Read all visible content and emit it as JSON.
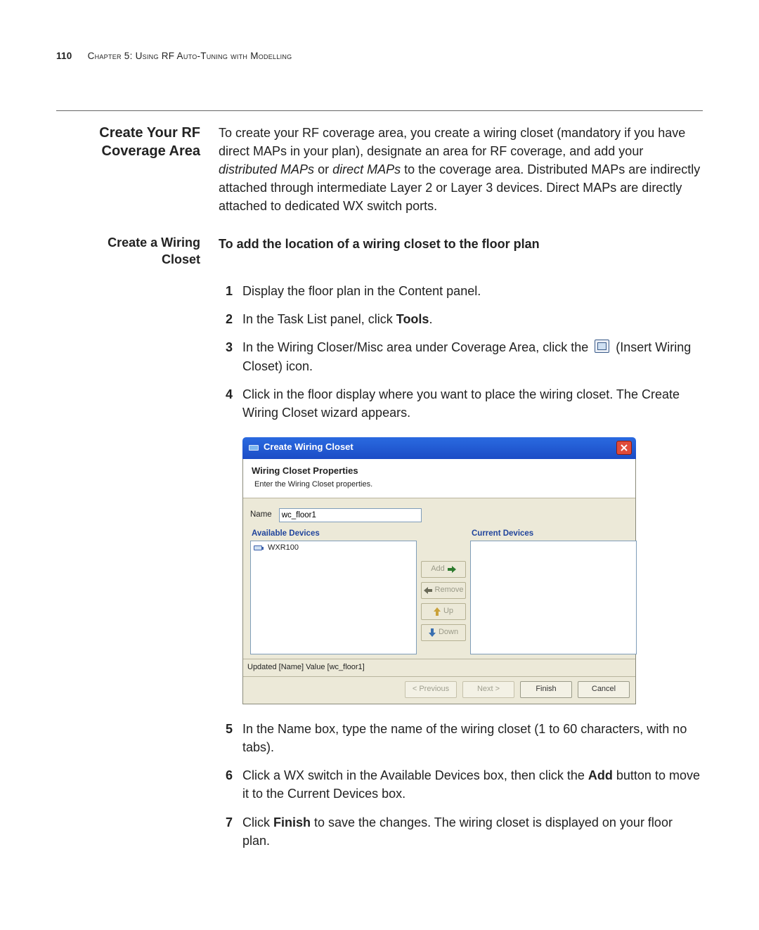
{
  "page": {
    "number": "110",
    "chapter_line": "Chapter 5: Using RF Auto-Tuning with Modelling"
  },
  "section": {
    "side_title_a": "Create Your RF",
    "side_title_b": "Coverage Area",
    "intro": "To create your RF coverage area, you create a wiring closet (mandatory if you have direct MAPs in your plan), designate an area for RF coverage, and add your ",
    "intro_em1": "distributed MAPs",
    "intro_mid": " or ",
    "intro_em2": "direct MAPs",
    "intro_tail": " to the coverage area. Distributed MAPs are indirectly attached through intermediate Layer 2 or Layer 3 devices. Direct MAPs are directly attached to dedicated WX switch ports."
  },
  "sub": {
    "side_a": "Create a Wiring",
    "side_b": "Closet",
    "lead": "To add the location of a wiring closet to the floor plan"
  },
  "steps_top": [
    {
      "n": "1",
      "text": "Display the floor plan in the Content panel."
    },
    {
      "n": "2",
      "pre": "In the Task List panel, click ",
      "bold": "Tools",
      "post": "."
    },
    {
      "n": "3",
      "pre": "In the Wiring Closer/Misc area under Coverage Area, click the ",
      "post_icon": " (Insert Wiring Closet) icon."
    },
    {
      "n": "4",
      "text": "Click in the floor display where you want to place the wiring closet. The Create Wiring Closet wizard appears."
    }
  ],
  "dialog": {
    "title": "Create Wiring Closet",
    "header_title": "Wiring Closet Properties",
    "header_sub": "Enter the Wiring Closet properties.",
    "name_label": "Name",
    "name_value": "wc_floor1",
    "available_label": "Available Devices",
    "current_label": "Current Devices",
    "available_items": [
      "WXR100"
    ],
    "buttons": {
      "add": "Add",
      "remove": "Remove",
      "up": "Up",
      "down": "Down"
    },
    "status": "Updated [Name] Value [wc_floor1]",
    "footer": {
      "prev": "< Previous",
      "next": "Next >",
      "finish": "Finish",
      "cancel": "Cancel"
    }
  },
  "steps_bottom": [
    {
      "n": "5",
      "text": "In the Name box, type the name of the wiring closet (1 to 60 characters, with no tabs)."
    },
    {
      "n": "6",
      "pre": "Click a WX switch in the Available Devices box, then click the ",
      "bold": "Add",
      "post": " button to move it to the Current Devices box."
    },
    {
      "n": "7",
      "pre": "Click ",
      "bold": "Finish",
      "post": " to save the changes. The wiring closet is displayed on your floor plan."
    }
  ]
}
